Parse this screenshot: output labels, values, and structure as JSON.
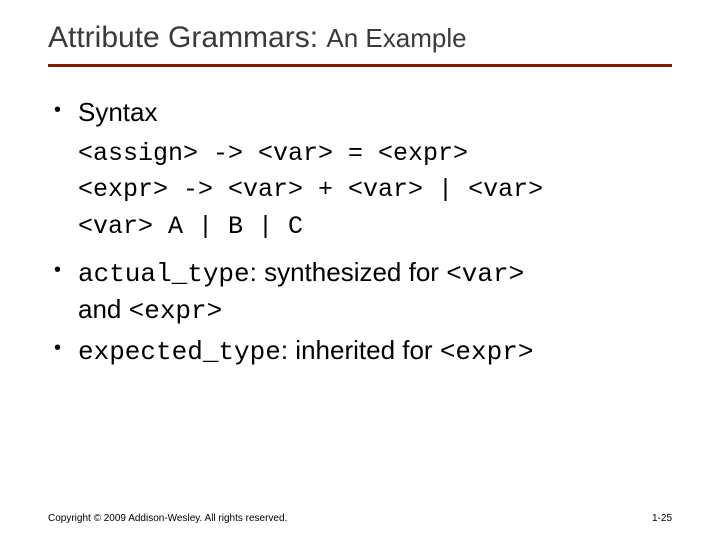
{
  "title_main": "Attribute Grammars: ",
  "title_sub": "An Example",
  "bullets": {
    "b1": "Syntax",
    "code1": "<assign> -> <var> = <expr>",
    "code2": "<expr> -> <var> + <var> | <var>",
    "code3": "<var> A | B | C",
    "b2_code": "actual_type",
    "b2_mid": ": synthesized for ",
    "b2_var": "<var>",
    "b2_and": "and ",
    "b2_expr": "<expr>",
    "b3_code": "expected_type",
    "b3_mid": ": inherited for ",
    "b3_expr": "<expr>"
  },
  "footer": {
    "copyright": "Copyright © 2009 Addison-Wesley. All rights reserved.",
    "page": "1-25"
  }
}
